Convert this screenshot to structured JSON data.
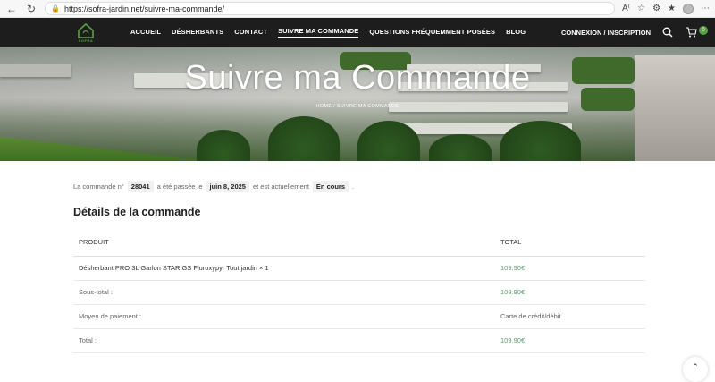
{
  "browser": {
    "url": "https://sofra-jardin.net/suivre-ma-commande/"
  },
  "header": {
    "logo_text": "SOFRA",
    "nav": [
      {
        "label": "ACCUEIL",
        "active": false
      },
      {
        "label": "DÉSHERBANTS",
        "active": false
      },
      {
        "label": "CONTACT",
        "active": false
      },
      {
        "label": "SUIVRE MA COMMANDE",
        "active": true
      },
      {
        "label": "QUESTIONS FRÉQUEMMENT POSÉES",
        "active": false
      },
      {
        "label": "BLOG",
        "active": false
      }
    ],
    "login": "CONNEXION / INSCRIPTION",
    "cart_count": "0"
  },
  "hero": {
    "title": "Suivre ma Commande",
    "breadcrumb_home": "HOME",
    "breadcrumb_sep": "/",
    "breadcrumb_current": "SUIVRE MA COMMANDE"
  },
  "order": {
    "text_1": "La commande n°",
    "number": "28041",
    "text_2": "a été passée le",
    "date": "juin 8, 2025",
    "text_3": "et est actuellement",
    "status": "En cours",
    "text_4": "."
  },
  "details": {
    "title": "Détails de la commande",
    "col_product": "PRODUIT",
    "col_total": "TOTAL",
    "rows": [
      {
        "label": "Désherbant PRO 3L Garlon STAR GS Fluroxypyr Tout jardin × 1",
        "value": "109.90€",
        "is_price": true
      },
      {
        "label": "Sous-total :",
        "value": "109.90€",
        "is_price": true
      },
      {
        "label": "Moyen de paiement :",
        "value": "Carte de crédit/débit",
        "is_price": false
      },
      {
        "label": "Total :",
        "value": "109.90€",
        "is_price": true
      }
    ]
  },
  "colors": {
    "header_bg": "#1d1d1d",
    "accent_green": "#5aa046",
    "price": "#5a9a6a"
  }
}
